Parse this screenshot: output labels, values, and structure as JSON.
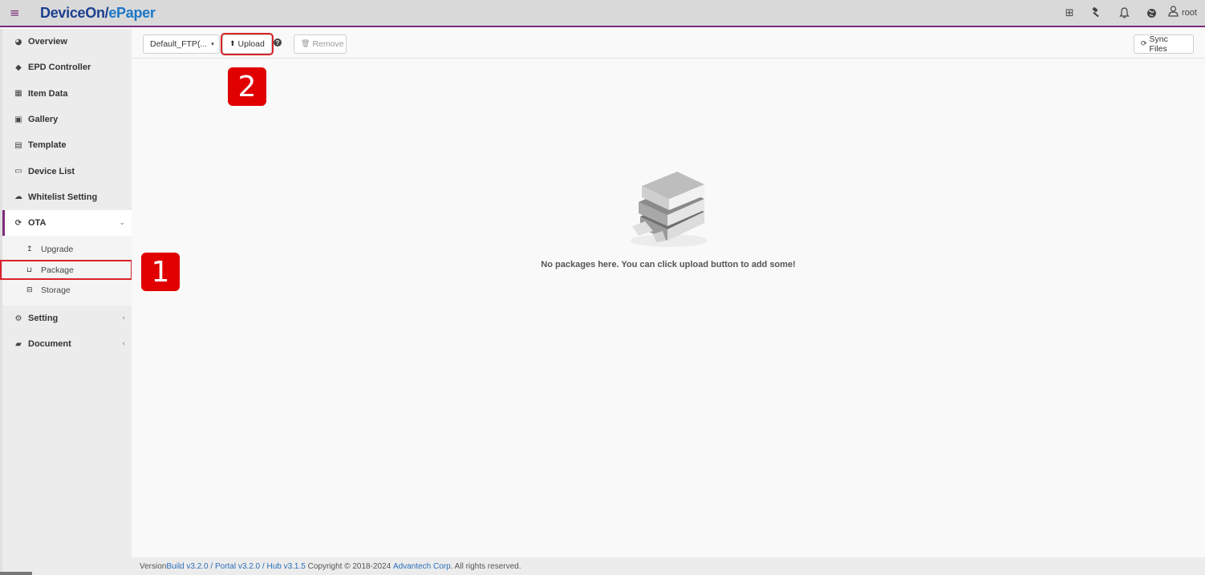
{
  "topbar": {
    "menu_icon": "hamburger-icon",
    "brand_main": "DeviceOn/",
    "brand_sub": "ePaper",
    "icons": [
      "plus-square-icon",
      "gavel-icon",
      "bell-icon",
      "globe-icon"
    ],
    "user_name": "root"
  },
  "sidebar": {
    "items": [
      {
        "label": "Overview",
        "icon": "dashboard-icon"
      },
      {
        "label": "EPD Controller",
        "icon": "tags-icon"
      },
      {
        "label": "Item Data",
        "icon": "table-icon"
      },
      {
        "label": "Gallery",
        "icon": "image-icon"
      },
      {
        "label": "Template",
        "icon": "id-card-icon"
      },
      {
        "label": "Device List",
        "icon": "monitor-icon"
      },
      {
        "label": "Whitelist Setting",
        "icon": "cloud-upload-icon"
      },
      {
        "label": "OTA",
        "icon": "refresh-icon"
      }
    ],
    "ota_sub": [
      {
        "label": "Upgrade",
        "icon": "upload-arrow-icon"
      },
      {
        "label": "Package",
        "icon": "inbox-icon"
      },
      {
        "label": "Storage",
        "icon": "hdd-icon"
      }
    ],
    "bottom": [
      {
        "label": "Setting",
        "icon": "cogs-icon"
      },
      {
        "label": "Document",
        "icon": "book-icon"
      }
    ]
  },
  "toolbar": {
    "dropdown_label": "Default_FTP(...",
    "upload_label": "Upload",
    "remove_label": "Remove",
    "sync_label": "Sync Files"
  },
  "main": {
    "empty_message": "No packages here. You can click upload button to add some!"
  },
  "footer": {
    "version_prefix": "Version ",
    "build": "Build v3.2.0",
    "sep1": " / ",
    "portal": "Portal v3.2.0",
    "sep2": " / ",
    "hub": "Hub v3.1.5",
    "copyright": " Copyright © 2018-2024 ",
    "company": "Advantech Corp",
    "rights": ". All rights reserved."
  },
  "annotations": {
    "step1": "1",
    "step2": "2"
  },
  "colors": {
    "accent": "#7a2a7a",
    "annotation_red": "#e00000",
    "link": "#2a6ebb"
  }
}
